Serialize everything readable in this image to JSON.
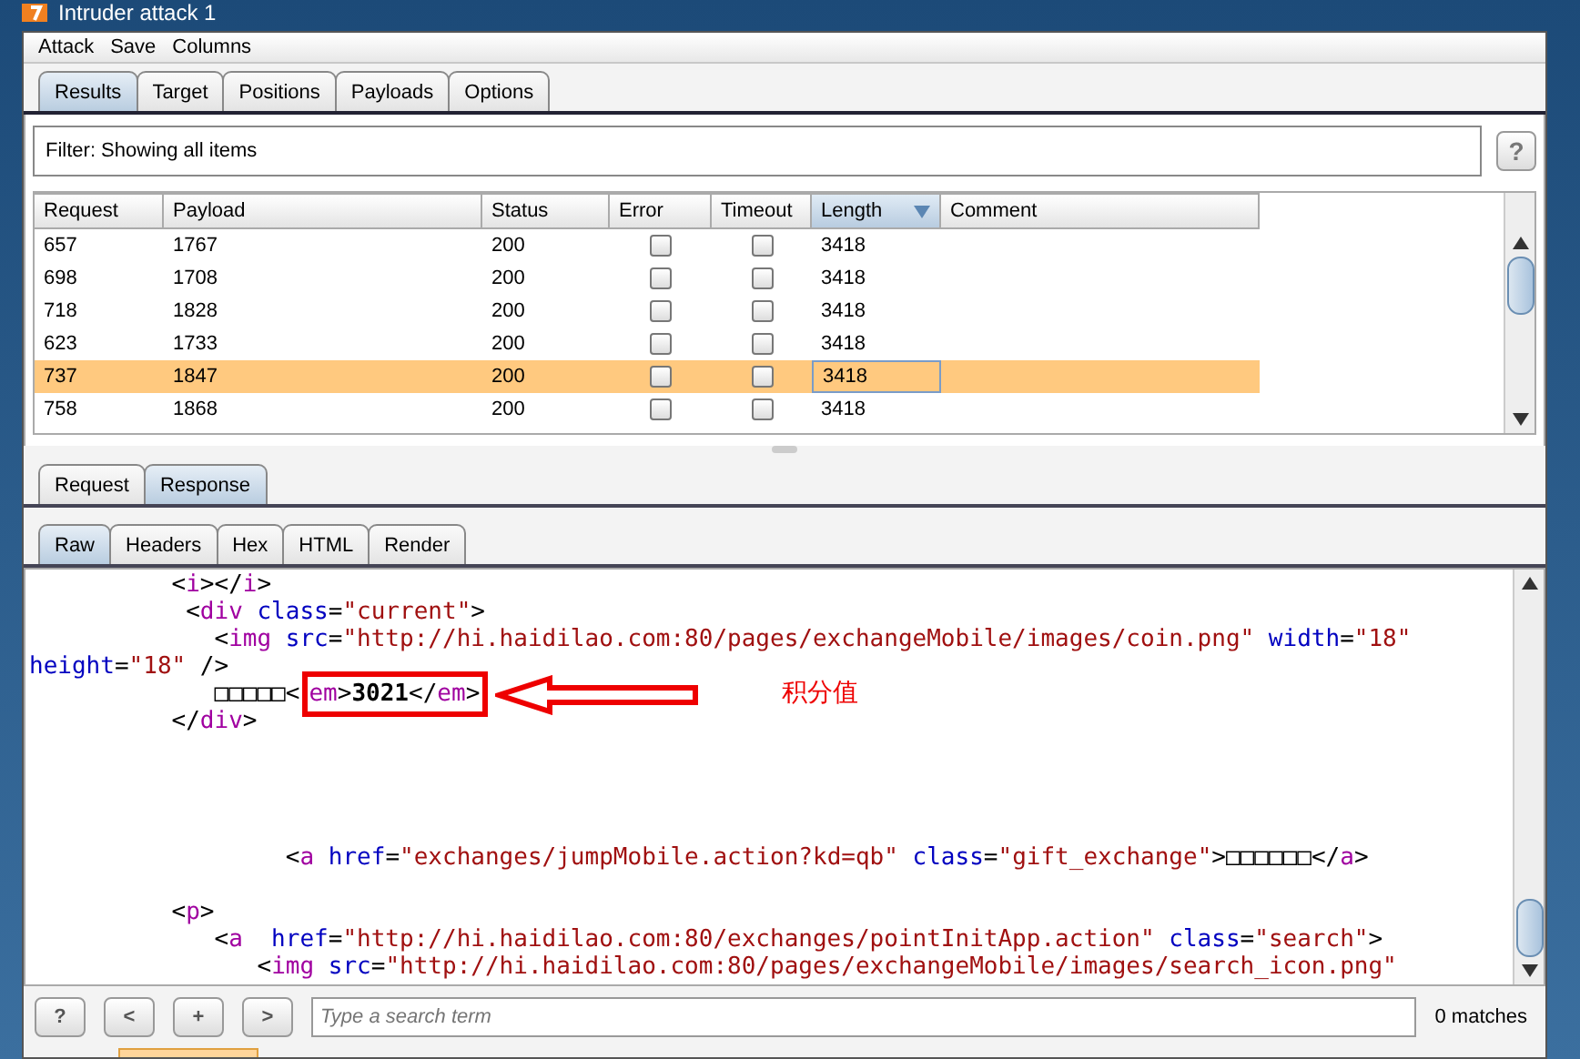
{
  "window": {
    "title": "Intruder attack 1"
  },
  "menu": [
    "Attack",
    "Save",
    "Columns"
  ],
  "tabs": [
    {
      "label": "Results",
      "selected": true
    },
    {
      "label": "Target",
      "selected": false
    },
    {
      "label": "Positions",
      "selected": false
    },
    {
      "label": "Payloads",
      "selected": false
    },
    {
      "label": "Options",
      "selected": false
    }
  ],
  "filter": {
    "text": "Filter:  Showing all items",
    "help": "?"
  },
  "table": {
    "columns": [
      {
        "label": "Request",
        "sorted": false
      },
      {
        "label": "Payload",
        "sorted": false
      },
      {
        "label": "Status",
        "sorted": false
      },
      {
        "label": "Error",
        "sorted": false
      },
      {
        "label": "Timeout",
        "sorted": false
      },
      {
        "label": "Length",
        "sorted": true
      },
      {
        "label": "Comment",
        "sorted": false
      }
    ],
    "rows": [
      {
        "request": "657",
        "payload": "1767",
        "status": "200",
        "error": false,
        "timeout": false,
        "length": "3418",
        "selected": false
      },
      {
        "request": "698",
        "payload": "1708",
        "status": "200",
        "error": false,
        "timeout": false,
        "length": "3418",
        "selected": false
      },
      {
        "request": "718",
        "payload": "1828",
        "status": "200",
        "error": false,
        "timeout": false,
        "length": "3418",
        "selected": false
      },
      {
        "request": "623",
        "payload": "1733",
        "status": "200",
        "error": false,
        "timeout": false,
        "length": "3418",
        "selected": false
      },
      {
        "request": "737",
        "payload": "1847",
        "status": "200",
        "error": false,
        "timeout": false,
        "length": "3418",
        "selected": true
      },
      {
        "request": "758",
        "payload": "1868",
        "status": "200",
        "error": false,
        "timeout": false,
        "length": "3418",
        "selected": false
      }
    ]
  },
  "message_tabs": [
    {
      "label": "Request",
      "selected": false
    },
    {
      "label": "Response",
      "selected": true
    }
  ],
  "view_tabs": [
    {
      "label": "Raw",
      "selected": true
    },
    {
      "label": "Headers",
      "selected": false
    },
    {
      "label": "Hex",
      "selected": false
    },
    {
      "label": "HTML",
      "selected": false
    },
    {
      "label": "Render",
      "selected": false
    }
  ],
  "code_lines": [
    {
      "segments": [
        {
          "kind": "punct",
          "text": "          <"
        },
        {
          "kind": "tag",
          "text": "i"
        },
        {
          "kind": "punct",
          "text": "></"
        },
        {
          "kind": "tag",
          "text": "i"
        },
        {
          "kind": "punct",
          "text": ">"
        }
      ]
    },
    {
      "segments": [
        {
          "kind": "punct",
          "text": "           <"
        },
        {
          "kind": "tag",
          "text": "div"
        },
        {
          "kind": "attr",
          "text": " class"
        },
        {
          "kind": "punct",
          "text": "="
        },
        {
          "kind": "value",
          "text": "\"current\""
        },
        {
          "kind": "punct",
          "text": ">"
        }
      ]
    },
    {
      "segments": [
        {
          "kind": "punct",
          "text": "             <"
        },
        {
          "kind": "tag",
          "text": "img"
        },
        {
          "kind": "attr",
          "text": " src"
        },
        {
          "kind": "punct",
          "text": "="
        },
        {
          "kind": "value",
          "text": "\"http://hi.haidilao.com:80/pages/exchangeMobile/images/coin.png\""
        },
        {
          "kind": "attr",
          "text": " width"
        },
        {
          "kind": "punct",
          "text": "="
        },
        {
          "kind": "value",
          "text": "\"18\""
        }
      ]
    },
    {
      "segments": [
        {
          "kind": "attr",
          "text": "height"
        },
        {
          "kind": "punct",
          "text": "="
        },
        {
          "kind": "value",
          "text": "\"18\""
        },
        {
          "kind": "punct",
          "text": " />"
        }
      ]
    },
    {
      "segments": [
        {
          "kind": "punct",
          "text": "             □□□□□<"
        }
      ],
      "boxed_segments": [
        {
          "kind": "tag",
          "text": "em"
        },
        {
          "kind": "punct",
          "text": ">"
        },
        {
          "kind": "bold",
          "text": "3021"
        },
        {
          "kind": "punct",
          "text": "</"
        },
        {
          "kind": "tag",
          "text": "em"
        },
        {
          "kind": "punct",
          "text": ">"
        }
      ],
      "annotation": "积分值"
    },
    {
      "segments": [
        {
          "kind": "punct",
          "text": "          </"
        },
        {
          "kind": "tag",
          "text": "div"
        },
        {
          "kind": "punct",
          "text": ">"
        }
      ]
    },
    {
      "kind": "blank"
    },
    {
      "kind": "blank"
    },
    {
      "kind": "blank"
    },
    {
      "kind": "blank"
    },
    {
      "segments": [
        {
          "kind": "punct",
          "text": "                  <"
        },
        {
          "kind": "tag",
          "text": "a"
        },
        {
          "kind": "attr",
          "text": " href"
        },
        {
          "kind": "punct",
          "text": "="
        },
        {
          "kind": "value",
          "text": "\"exchanges/jumpMobile.action?kd=qb\""
        },
        {
          "kind": "attr",
          "text": " class"
        },
        {
          "kind": "punct",
          "text": "="
        },
        {
          "kind": "value",
          "text": "\"gift_exchange\""
        },
        {
          "kind": "punct",
          "text": ">□□□□□□</"
        },
        {
          "kind": "tag",
          "text": "a"
        },
        {
          "kind": "punct",
          "text": ">"
        }
      ]
    },
    {
      "kind": "blank"
    },
    {
      "segments": [
        {
          "kind": "punct",
          "text": "          <"
        },
        {
          "kind": "tag",
          "text": "p"
        },
        {
          "kind": "punct",
          "text": ">"
        }
      ]
    },
    {
      "segments": [
        {
          "kind": "punct",
          "text": "             <"
        },
        {
          "kind": "tag",
          "text": "a"
        },
        {
          "kind": "attr",
          "text": "  href"
        },
        {
          "kind": "punct",
          "text": "="
        },
        {
          "kind": "value",
          "text": "\"http://hi.haidilao.com:80/exchanges/pointInitApp.action\""
        },
        {
          "kind": "attr",
          "text": " class"
        },
        {
          "kind": "punct",
          "text": "="
        },
        {
          "kind": "value",
          "text": "\"search\""
        },
        {
          "kind": "punct",
          "text": ">"
        }
      ]
    },
    {
      "segments": [
        {
          "kind": "punct",
          "text": "                <"
        },
        {
          "kind": "tag",
          "text": "img"
        },
        {
          "kind": "attr",
          "text": " src"
        },
        {
          "kind": "punct",
          "text": "="
        },
        {
          "kind": "value",
          "text": "\"http://hi.haidilao.com:80/pages/exchangeMobile/images/search_icon.png\""
        }
      ]
    }
  ],
  "search_bar": {
    "buttons": [
      "?",
      "<",
      "+",
      ">"
    ],
    "placeholder": "Type a search term",
    "matches": "0 matches"
  }
}
